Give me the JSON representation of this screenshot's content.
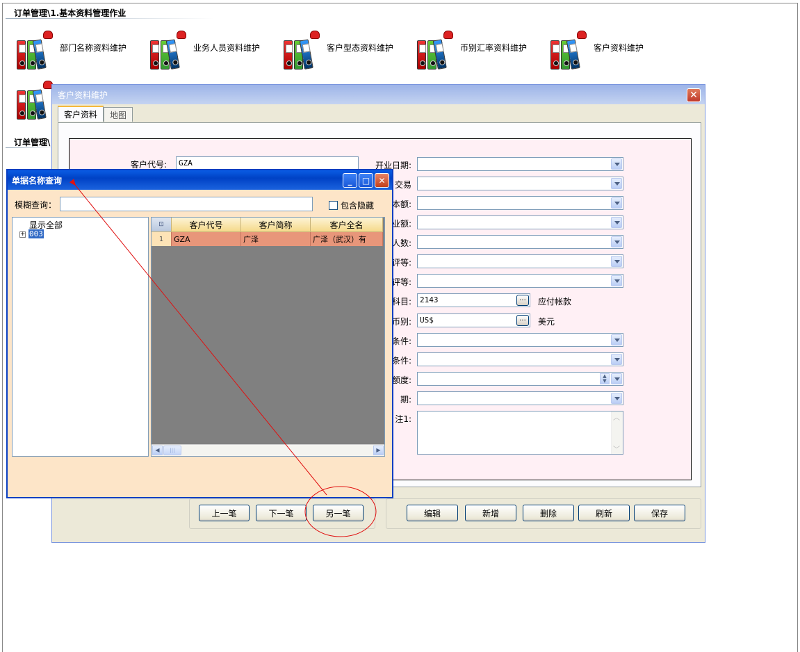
{
  "background": {
    "section1_title": "订单管理\\1.基本资料管理作业",
    "section2_title": "订单管理\\",
    "modules": [
      {
        "label": "部门名称资料维护"
      },
      {
        "label": "业务人员资料维护"
      },
      {
        "label": "客户型态资料维护"
      },
      {
        "label": "币别汇率资料维护"
      },
      {
        "label": "客户资料维护"
      }
    ]
  },
  "main_dialog": {
    "title": "客户资料维护",
    "close_glyph": "✕",
    "tabs": [
      {
        "label": "客户资料",
        "active": true
      },
      {
        "label": "地图",
        "active": false
      }
    ],
    "left_fields": [
      {
        "label": "客户代号:",
        "value": "GZA"
      }
    ],
    "right_fields": [
      {
        "label": "开业日期:",
        "type": "combo"
      },
      {
        "label": "交易",
        "type": "combo"
      },
      {
        "label": "本额:",
        "type": "combo"
      },
      {
        "label": "业额:",
        "type": "combo"
      },
      {
        "label": "人数:",
        "type": "combo"
      },
      {
        "label": "评等:",
        "type": "combo"
      },
      {
        "label": "评等:",
        "type": "combo"
      },
      {
        "label": "科目:",
        "type": "lookup",
        "value": "2143",
        "desc": "应付帐款"
      },
      {
        "label": "币别:",
        "type": "lookup",
        "value": "US$",
        "desc": "美元"
      },
      {
        "label": "条件:",
        "type": "combo"
      },
      {
        "label": "条件:",
        "type": "combo"
      },
      {
        "label": "额度:",
        "type": "spin"
      },
      {
        "label": "期:",
        "type": "combo"
      },
      {
        "label": "注1:",
        "type": "memo"
      }
    ],
    "nav_buttons": [
      "上一笔",
      "下一笔",
      "另一笔"
    ],
    "action_buttons": [
      "编辑",
      "新增",
      "删除",
      "刷新",
      "保存"
    ],
    "lookup_glyph": "..."
  },
  "query_dialog": {
    "title": "单据名称查询",
    "search_label": "模糊查询：",
    "search_value": "",
    "include_hidden_label": "包含隐藏",
    "include_hidden_checked": false,
    "window_glyphs": {
      "minimize": "_",
      "maximize": "□",
      "close": "✕"
    },
    "tree": [
      {
        "label": "显示全部"
      },
      {
        "label": "003",
        "selected": true,
        "expander": "+"
      }
    ],
    "grid": {
      "corner_glyph": "⊡",
      "columns": [
        "客户代号",
        "客户简称",
        "客户全名"
      ],
      "rows": [
        {
          "num": "1",
          "cells": [
            "GZA",
            "广泽",
            "广泽（武汉）有"
          ]
        }
      ]
    },
    "scroll_glyphs": {
      "left": "◀",
      "right": "▶",
      "grip": "|||"
    }
  },
  "annotation": {
    "color": "#e01010"
  }
}
